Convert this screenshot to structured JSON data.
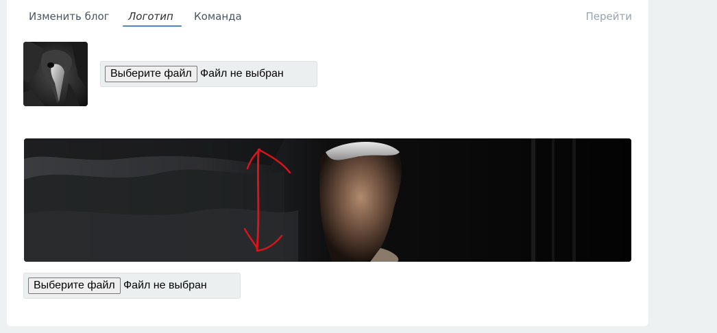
{
  "tabs": {
    "edit_blog": "Изменить блог",
    "logo": "Логотип",
    "team": "Команда",
    "go": "Перейти"
  },
  "avatar_upload": {
    "button_label": "Выберите файл",
    "status": "Файл не выбран"
  },
  "cover_upload": {
    "button_label": "Выберите файл",
    "status": "Файл не выбран"
  },
  "colors": {
    "active_tab_underline": "#4a86c8",
    "cover_annotation": "#d9141a"
  }
}
